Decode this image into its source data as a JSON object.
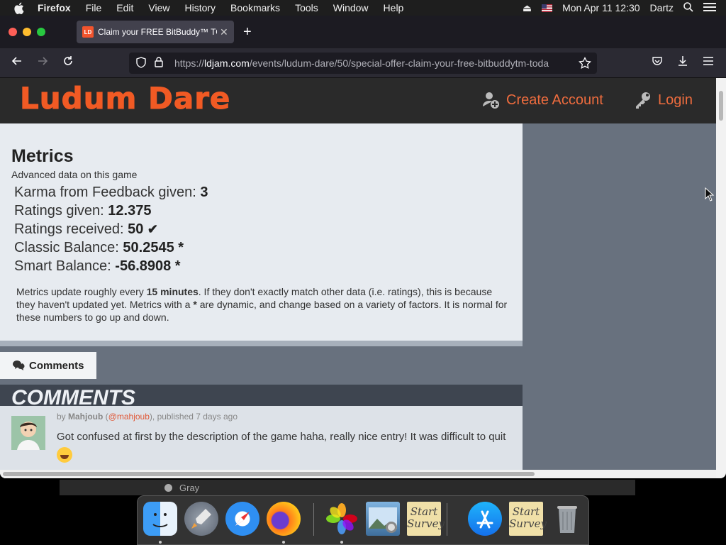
{
  "menubar": {
    "app_name": "Firefox",
    "items": [
      "File",
      "Edit",
      "View",
      "History",
      "Bookmarks",
      "Tools",
      "Window",
      "Help"
    ],
    "clock": "Mon Apr 11  12:30",
    "user": "Dartz"
  },
  "browser": {
    "tab_title": "Claim your FREE BitBuddy™ TO",
    "favicon_text": "LD",
    "url_host": "ldjam.com",
    "url_prefix": "https://",
    "url_path": "/events/ludum-dare/50/special-offer-claim-your-free-bitbuddytm-toda"
  },
  "site": {
    "logo": "Ludum Dare",
    "create_account": "Create Account",
    "login": "Login",
    "accent_color": "#ee6c3e"
  },
  "metrics": {
    "title": "Metrics",
    "subtitle": "Advanced data on this game",
    "rows": [
      {
        "label": "Karma from Feedback given: ",
        "value": "3",
        "suffix": ""
      },
      {
        "label": "Ratings given: ",
        "value": "12.375",
        "suffix": ""
      },
      {
        "label": "Ratings received: ",
        "value": "50",
        "suffix": "✔"
      },
      {
        "label": "Classic Balance: ",
        "value": "50.2545 *",
        "suffix": ""
      },
      {
        "label": "Smart Balance: ",
        "value": "-56.8908 *",
        "suffix": ""
      }
    ],
    "note_1": "Metrics update roughly every ",
    "note_bold_1": "15 minutes",
    "note_2": ". If they don't exactly match other data (i.e. ratings), this is because they haven't updated yet. Metrics with a ",
    "note_bold_2": "*",
    "note_3": " are dynamic, and change based on a variety of factors. It is normal for these numbers to go up and down."
  },
  "comments": {
    "tab_label": "Comments",
    "header": "COMMENTS",
    "items": [
      {
        "by": "by ",
        "author": "Mahjoub",
        "handle": "@mahjoub",
        "meta": ", published 7 days ago",
        "body": "Got confused at first by the description of the game haha, really nice entry! It was difficult to quit"
      }
    ]
  },
  "background_window": {
    "item_label": "Gray"
  },
  "dock": {
    "items": [
      "finder-icon",
      "launchpad-icon",
      "safari-icon",
      "firefox-icon",
      "photos-icon",
      "preview-icon",
      "start-survey-note",
      "app-store-icon",
      "start-survey-note",
      "trash-icon"
    ],
    "note_text": "Start Survey"
  }
}
